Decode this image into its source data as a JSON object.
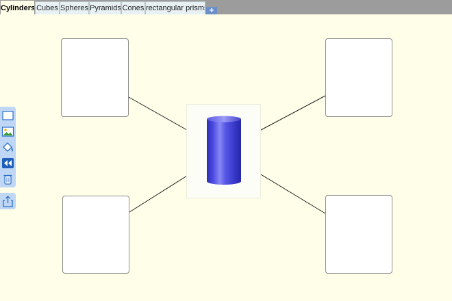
{
  "tabs": [
    {
      "label": "Cylinders",
      "active": true
    },
    {
      "label": "Cubes",
      "active": false
    },
    {
      "label": "Spheres",
      "active": false
    },
    {
      "label": "Pyramids",
      "active": false
    },
    {
      "label": "Cones",
      "active": false
    },
    {
      "label": "rectangular prisms",
      "active": false
    }
  ],
  "add_tab_label": "+",
  "center_image": "cylinder",
  "colors": {
    "canvas_background": "#fefee9",
    "tab_bar": "#9c9c9c",
    "toolbar": "#bfd6f5",
    "cylinder": "#4040d8"
  },
  "toolbar": {
    "icons": [
      "rectangle-icon",
      "insert-image-icon",
      "fill-color-icon",
      "arrange-icon",
      "trash-icon"
    ],
    "secondary_icons": [
      "export-icon"
    ]
  }
}
